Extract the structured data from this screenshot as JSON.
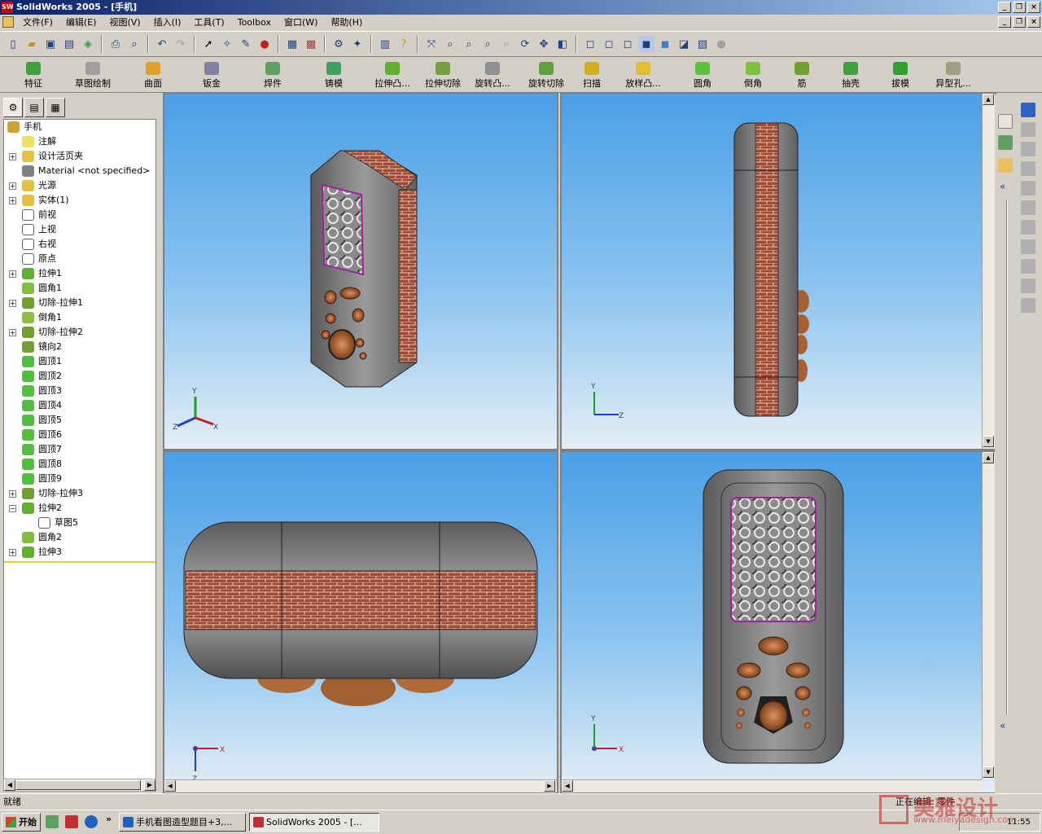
{
  "window": {
    "title": "SolidWorks 2005 - [手机]",
    "app_icon": "SW"
  },
  "menu": [
    "文件(F)",
    "编辑(E)",
    "视图(V)",
    "插入(I)",
    "工具(T)",
    "Toolbox",
    "窗口(W)",
    "帮助(H)"
  ],
  "feature_toolbar": [
    "特征",
    "草图绘制",
    "曲面",
    "钣金",
    "焊件",
    "铸模",
    "拉伸凸...",
    "拉伸切除",
    "旋转凸...",
    "旋转切除",
    "扫描",
    "放样凸...",
    "圆角",
    "倒角",
    "筋",
    "抽壳",
    "拔模",
    "异型孔..."
  ],
  "tree": {
    "root": "手机",
    "items": [
      {
        "label": "注解",
        "icon": "annotation-icon",
        "exp": false
      },
      {
        "label": "设计活页夹",
        "icon": "design-binder-icon",
        "exp": true
      },
      {
        "label": "Material <not specified>",
        "icon": "material-icon",
        "exp": false
      },
      {
        "label": "光源",
        "icon": "lights-icon",
        "exp": true
      },
      {
        "label": "实体(1)",
        "icon": "solid-bodies-icon",
        "exp": true
      },
      {
        "label": "前视",
        "icon": "plane-icon",
        "exp": false
      },
      {
        "label": "上视",
        "icon": "plane-icon",
        "exp": false
      },
      {
        "label": "右视",
        "icon": "plane-icon",
        "exp": false
      },
      {
        "label": "原点",
        "icon": "origin-icon",
        "exp": false
      },
      {
        "label": "拉伸1",
        "icon": "extrude-icon",
        "exp": true
      },
      {
        "label": "圆角1",
        "icon": "fillet-icon",
        "exp": false
      },
      {
        "label": "切除-拉伸1",
        "icon": "cut-extrude-icon",
        "exp": true
      },
      {
        "label": "倒角1",
        "icon": "chamfer-icon",
        "exp": false
      },
      {
        "label": "切除-拉伸2",
        "icon": "cut-extrude-icon",
        "exp": true
      },
      {
        "label": "镜向2",
        "icon": "mirror-icon",
        "exp": false
      },
      {
        "label": "圆顶1",
        "icon": "dome-icon",
        "exp": false
      },
      {
        "label": "圆顶2",
        "icon": "dome-icon",
        "exp": false
      },
      {
        "label": "圆顶3",
        "icon": "dome-icon",
        "exp": false
      },
      {
        "label": "圆顶4",
        "icon": "dome-icon",
        "exp": false
      },
      {
        "label": "圆顶5",
        "icon": "dome-icon",
        "exp": false
      },
      {
        "label": "圆顶6",
        "icon": "dome-icon",
        "exp": false
      },
      {
        "label": "圆顶7",
        "icon": "dome-icon",
        "exp": false
      },
      {
        "label": "圆顶8",
        "icon": "dome-icon",
        "exp": false
      },
      {
        "label": "圆顶9",
        "icon": "dome-icon",
        "exp": false
      },
      {
        "label": "切除-拉伸3",
        "icon": "cut-extrude-icon",
        "exp": true
      },
      {
        "label": "拉伸2",
        "icon": "extrude-icon",
        "exp": true,
        "expanded": true
      },
      {
        "label": "草图5",
        "icon": "sketch-icon",
        "exp": false,
        "child": true
      },
      {
        "label": "圆角2",
        "icon": "fillet-icon",
        "exp": false
      },
      {
        "label": "拉伸3",
        "icon": "extrude-icon",
        "exp": true
      }
    ]
  },
  "axes": {
    "x": "X",
    "y": "Y",
    "z": "Z"
  },
  "status": {
    "left": "就绪",
    "right": "正在编辑: 零件"
  },
  "taskbar": {
    "start": "开始",
    "tasks": [
      "手机看图造型题目+3,...",
      "SolidWorks 2005 - [..."
    ],
    "time": "11:55"
  },
  "watermark": {
    "text": "美雅设计",
    "url": "www.meiyadesign.com"
  },
  "colors": {
    "title_start": "#0a246a",
    "title_end": "#a6caf0",
    "viewport_top": "#4a9fe6",
    "viewport_bottom": "#e4eef6",
    "body_gray": "#8a8a8a",
    "brick": "#a8503a",
    "button_brown": "#b06a38"
  }
}
